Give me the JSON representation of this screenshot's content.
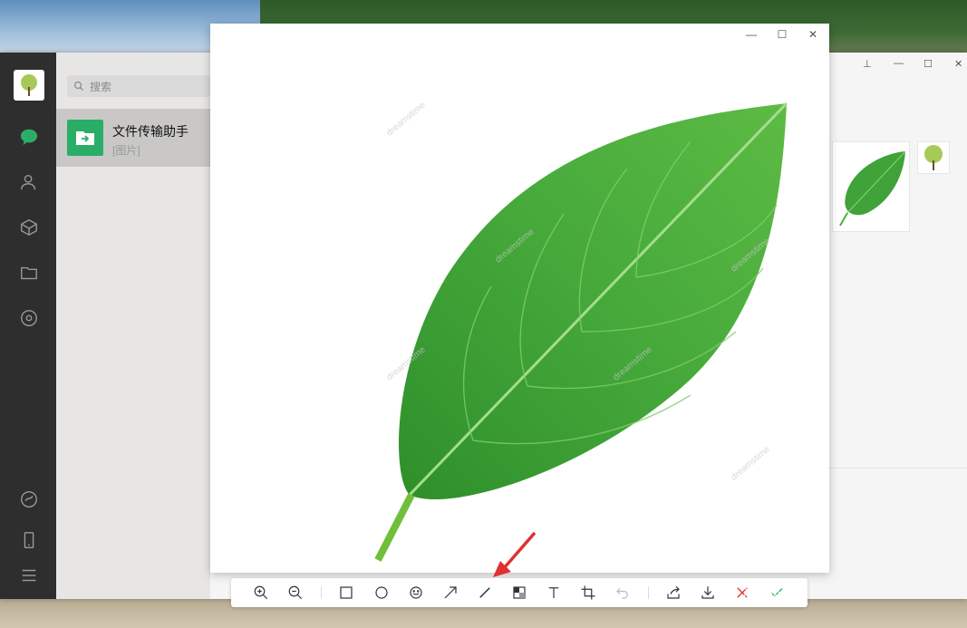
{
  "sidebar": {
    "search_placeholder": "搜索",
    "chat": {
      "name": "文件传输助手",
      "preview": "[图片]"
    }
  },
  "viewer": {
    "controls": {
      "minimize": "—",
      "maximize": "☐",
      "close": "✕"
    }
  },
  "right_window": {
    "controls": {
      "pin": "⊥",
      "minimize": "—",
      "maximize": "☐",
      "close": "✕"
    }
  },
  "watermarks": [
    "dreamstime"
  ],
  "overlay_watermark": "jingyan",
  "colors": {
    "accent": "#2aae67",
    "rail": "#2e2e2e",
    "leaf": "#3fa33a",
    "arrow": "#e03131",
    "confirm": "#2aae67",
    "cancel": "#e03131"
  },
  "toolbar": {
    "icons": [
      "zoom-in-icon",
      "zoom-out-icon",
      "rectangle-icon",
      "ellipse-icon",
      "emoji-icon",
      "arrow-icon",
      "pen-icon",
      "mosaic-icon",
      "text-icon",
      "crop-icon",
      "undo-icon",
      "share-icon",
      "download-icon",
      "cancel-icon",
      "confirm-icon"
    ]
  }
}
